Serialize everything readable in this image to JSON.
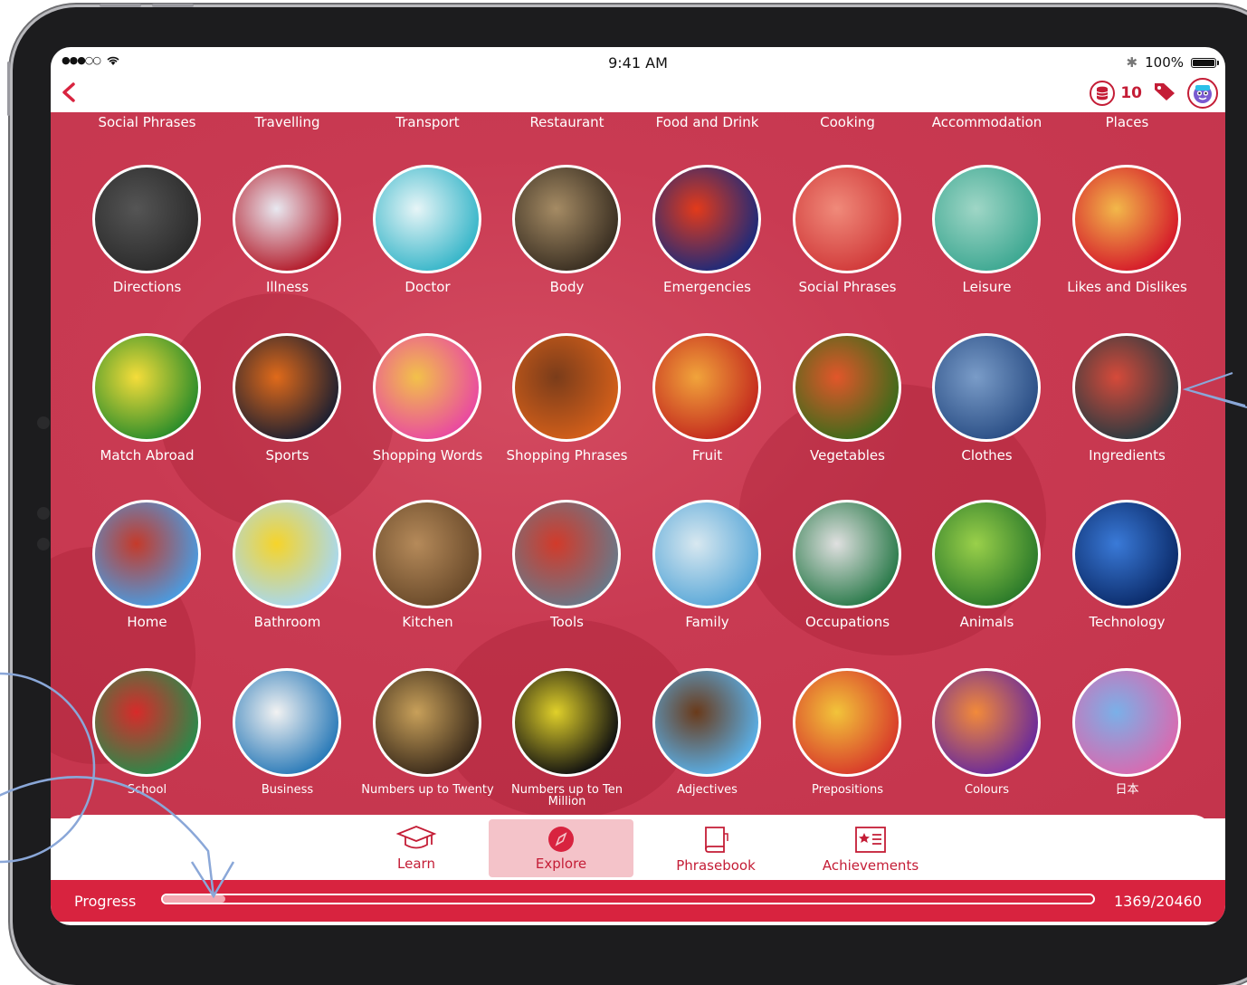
{
  "status": {
    "time": "9:41 AM",
    "battery": "100%"
  },
  "header": {
    "coins": "10"
  },
  "top_categories": [
    "Social Phrases",
    "Travelling",
    "Transport",
    "Restaurant",
    "Food and Drink",
    "Cooking",
    "Accommodation",
    "Places"
  ],
  "categories": [
    {
      "label": "Directions"
    },
    {
      "label": "Illness"
    },
    {
      "label": "Doctor"
    },
    {
      "label": "Body"
    },
    {
      "label": "Emergencies"
    },
    {
      "label": "Social Phrases"
    },
    {
      "label": "Leisure"
    },
    {
      "label": "Likes and Dislikes"
    },
    {
      "label": "Match Abroad"
    },
    {
      "label": "Sports"
    },
    {
      "label": "Shopping Words"
    },
    {
      "label": "Shopping Phrases"
    },
    {
      "label": "Fruit"
    },
    {
      "label": "Vegetables"
    },
    {
      "label": "Clothes"
    },
    {
      "label": "Ingredients"
    },
    {
      "label": "Home"
    },
    {
      "label": "Bathroom"
    },
    {
      "label": "Kitchen"
    },
    {
      "label": "Tools"
    },
    {
      "label": "Family"
    },
    {
      "label": "Occupations"
    },
    {
      "label": "Animals"
    },
    {
      "label": "Technology"
    },
    {
      "label": "School"
    },
    {
      "label": "Business"
    },
    {
      "label": "Numbers up to Twenty"
    },
    {
      "label": "Numbers up to Ten Million"
    },
    {
      "label": "Adjectives"
    },
    {
      "label": "Prepositions"
    },
    {
      "label": "Colours"
    },
    {
      "label": "日本"
    }
  ],
  "tabs": [
    {
      "label": "Learn",
      "icon": "graduation-cap-icon",
      "active": false
    },
    {
      "label": "Explore",
      "icon": "compass-icon",
      "active": true
    },
    {
      "label": "Phrasebook",
      "icon": "book-icon",
      "active": false
    },
    {
      "label": "Achievements",
      "icon": "certificate-icon",
      "active": false
    }
  ],
  "progress": {
    "label": "Progress",
    "count": "1369/20460",
    "fraction": 0.067
  },
  "colors": {
    "accent": "#d8233f",
    "background": "#c93a52",
    "active_tab": "#f4c3c9"
  }
}
